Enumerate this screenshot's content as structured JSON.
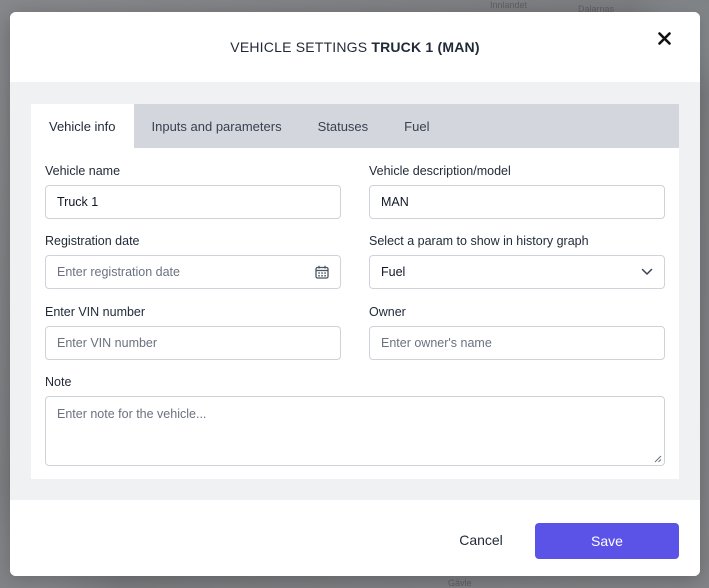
{
  "modal": {
    "title_prefix": "VEHICLE SETTINGS",
    "title_vehicle": "TRUCK 1 (MAN)",
    "close_icon": "close-icon"
  },
  "tabs": [
    {
      "label": "Vehicle info",
      "active": true
    },
    {
      "label": "Inputs and parameters",
      "active": false
    },
    {
      "label": "Statuses",
      "active": false
    },
    {
      "label": "Fuel",
      "active": false
    }
  ],
  "form": {
    "vehicle_name": {
      "label": "Vehicle name",
      "value": "Truck 1"
    },
    "vehicle_description": {
      "label": "Vehicle description/model",
      "value": "MAN"
    },
    "registration_date": {
      "label": "Registration date",
      "placeholder": "Enter registration date",
      "icon": "calendar-icon"
    },
    "history_param": {
      "label": "Select a param to show in history graph",
      "value": "Fuel",
      "icon": "chevron-down-icon"
    },
    "vin": {
      "label": "Enter VIN number",
      "placeholder": "Enter VIN number"
    },
    "owner": {
      "label": "Owner",
      "placeholder": "Enter owner's name"
    },
    "note": {
      "label": "Note",
      "placeholder": "Enter note for the vehicle..."
    }
  },
  "footer": {
    "cancel_label": "Cancel",
    "save_label": "Save"
  },
  "colors": {
    "accent": "#5b53e8",
    "tab_bar": "#d3d6dc",
    "backdrop": "#7f8083"
  },
  "backdrop_labels": [
    "Innlandet",
    "Dalarnas",
    "Gävle"
  ]
}
